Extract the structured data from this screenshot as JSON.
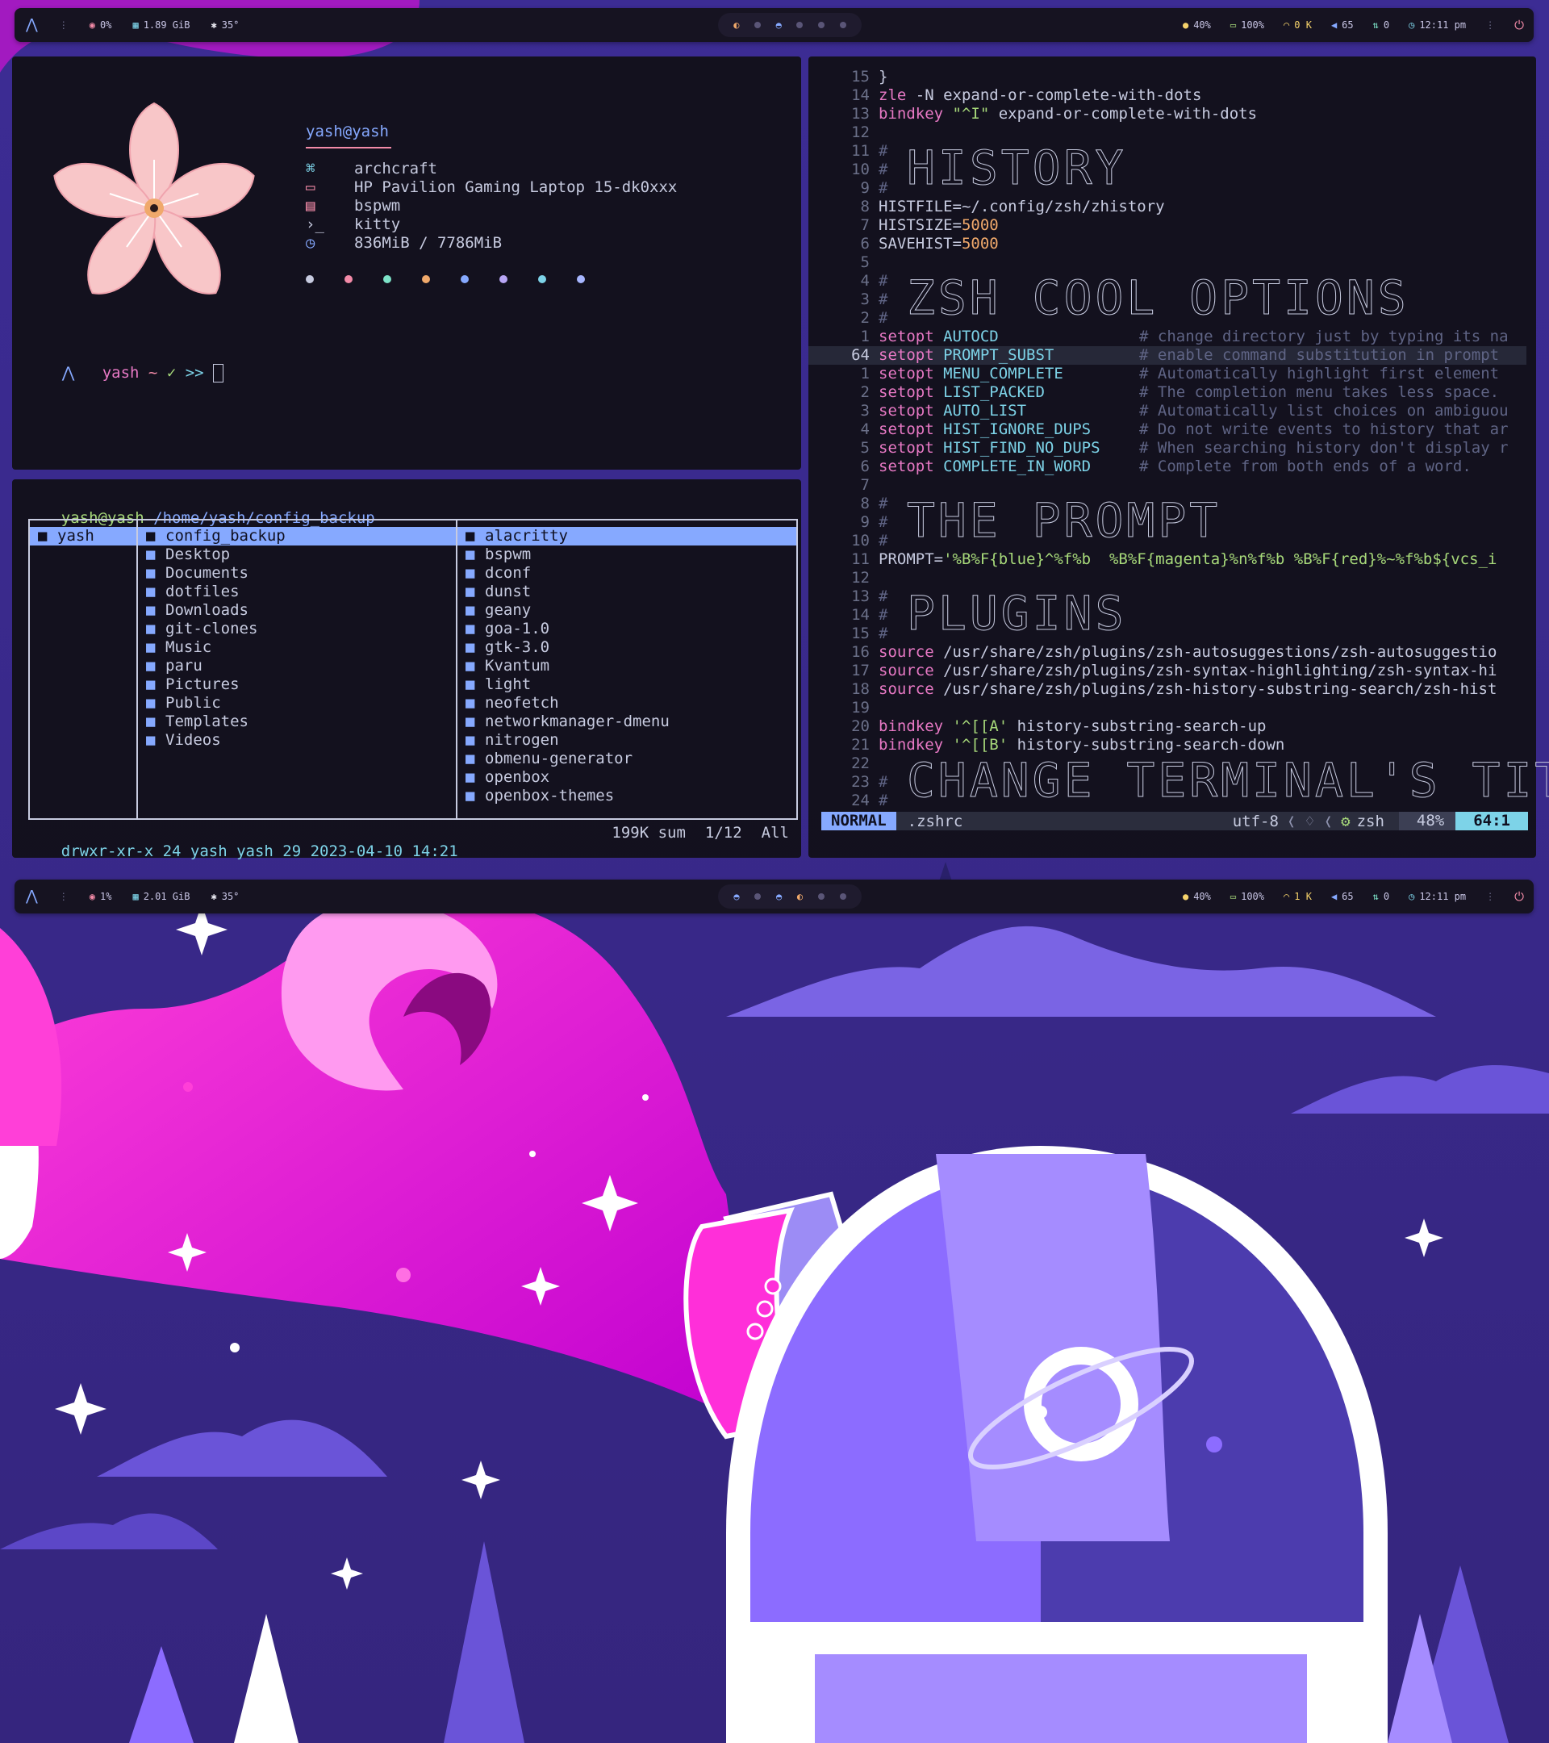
{
  "top_bar": {
    "cpu": "0%",
    "memory": "1.89 GiB",
    "temp": "35°",
    "brightness": "40%",
    "battery": "100%",
    "network": "0 K",
    "volume": "65",
    "updates": "0",
    "time": "12:11 pm"
  },
  "bottom_bar": {
    "cpu": "1%",
    "memory": "2.01 GiB",
    "temp": "35°",
    "brightness": "40%",
    "battery": "100%",
    "network": "1 K",
    "volume": "65",
    "updates": "0",
    "time": "12:11 pm"
  },
  "fetch": {
    "user_host": "yash@yash",
    "distro": "archcraft",
    "host": "HP Pavilion Gaming Laptop 15-dk0xxx",
    "wm": "bspwm",
    "terminal": "kitty",
    "memory": "836MiB / 7786MiB",
    "color_dots": [
      "#c7cbe0",
      "#f38ba8",
      "#7de3c8",
      "#f0a96b",
      "#86a9ff",
      "#b8a6f5",
      "#7dd3e8",
      "#a7b6ff"
    ],
    "prompt_user": "yash",
    "prompt_tilde": "~",
    "prompt_check": "✓",
    "prompt_arrows": ">>"
  },
  "ranger": {
    "header_user": "yash@yash",
    "header_path": "/home/yash/config_backup",
    "col1": [
      "yash"
    ],
    "col2": [
      "config_backup",
      "Desktop",
      "Documents",
      "dotfiles",
      "Downloads",
      "git-clones",
      "Music",
      "paru",
      "Pictures",
      "Public",
      "Templates",
      "Videos"
    ],
    "col3": [
      "alacritty",
      "bspwm",
      "dconf",
      "dunst",
      "geany",
      "goa-1.0",
      "gtk-3.0",
      "Kvantum",
      "light",
      "neofetch",
      "networkmanager-dmenu",
      "nitrogen",
      "obmenu-generator",
      "openbox",
      "openbox-themes"
    ],
    "status_left": "drwxr-xr-x 24 yash yash 29 2023-04-10 14:21",
    "status_size": "199K sum",
    "status_pos": "1/12",
    "status_all": "All"
  },
  "nvim": {
    "lines": [
      {
        "n": "15",
        "code": "}"
      },
      {
        "n": "14",
        "code": "zle -N expand-or-complete-with-dots"
      },
      {
        "n": "13",
        "code": "bindkey \"^I\" expand-or-complete-with-dots"
      },
      {
        "n": "12",
        "code": ""
      },
      {
        "n": "11",
        "code": "#"
      },
      {
        "n": "10",
        "code": "#"
      },
      {
        "n": "9",
        "code": "#"
      },
      {
        "n": "8",
        "code": "HISTFILE=~/.config/zsh/zhistory"
      },
      {
        "n": "7",
        "code": "HISTSIZE=5000"
      },
      {
        "n": "6",
        "code": "SAVEHIST=5000"
      },
      {
        "n": "5",
        "code": ""
      },
      {
        "n": "4",
        "code": "#"
      },
      {
        "n": "3",
        "code": "#"
      },
      {
        "n": "2",
        "code": "#"
      },
      {
        "n": "1",
        "code": "setopt AUTOCD"
      },
      {
        "n": "64",
        "code": "setopt PROMPT_SUBST"
      },
      {
        "n": "1",
        "code": "setopt MENU_COMPLETE"
      },
      {
        "n": "2",
        "code": "setopt LIST_PACKED"
      },
      {
        "n": "3",
        "code": "setopt AUTO_LIST"
      },
      {
        "n": "4",
        "code": "setopt HIST_IGNORE_DUPS"
      },
      {
        "n": "5",
        "code": "setopt HIST_FIND_NO_DUPS"
      },
      {
        "n": "6",
        "code": "setopt COMPLETE_IN_WORD"
      },
      {
        "n": "7",
        "code": ""
      },
      {
        "n": "8",
        "code": "#"
      },
      {
        "n": "9",
        "code": "#"
      },
      {
        "n": "10",
        "code": "#"
      },
      {
        "n": "11",
        "code": "PROMPT='%B%F{blue}^%f%b  %B%F{magenta}%n%f%b %B%F{red}%~%f%b${vcs_i"
      },
      {
        "n": "12",
        "code": ""
      },
      {
        "n": "13",
        "code": "#"
      },
      {
        "n": "14",
        "code": "#"
      },
      {
        "n": "15",
        "code": "#"
      },
      {
        "n": "16",
        "code": "source /usr/share/zsh/plugins/zsh-autosuggestions/zsh-autosuggestio"
      },
      {
        "n": "17",
        "code": "source /usr/share/zsh/plugins/zsh-syntax-highlighting/zsh-syntax-hi"
      },
      {
        "n": "18",
        "code": "source /usr/share/zsh/plugins/zsh-history-substring-search/zsh-hist"
      },
      {
        "n": "19",
        "code": ""
      },
      {
        "n": "20",
        "code": "bindkey '^[[A' history-substring-search-up"
      },
      {
        "n": "21",
        "code": "bindkey '^[[B' history-substring-search-down"
      },
      {
        "n": "22",
        "code": ""
      },
      {
        "n": "23",
        "code": "#"
      },
      {
        "n": "24",
        "code": "#"
      }
    ],
    "comments": [
      "# change directory just by typing its na",
      "# enable command substitution in prompt",
      "# Automatically highlight first element",
      "# The completion menu takes less space.",
      "# Automatically list choices on ambiguou",
      "# Do not write events to history that ar",
      "# When searching history don't display r",
      "# Complete from both ends of a word."
    ],
    "headings": [
      "HISTORY",
      "ZSH COOL OPTIONS",
      "THE PROMPT",
      "PLUGINS",
      "CHANGE TERMINAL'S TITLE"
    ],
    "status": {
      "mode": "NORMAL",
      "file": ".zshrc",
      "encoding": "utf-8",
      "filetype": "zsh",
      "percent": "48%",
      "position": "64:1"
    }
  }
}
